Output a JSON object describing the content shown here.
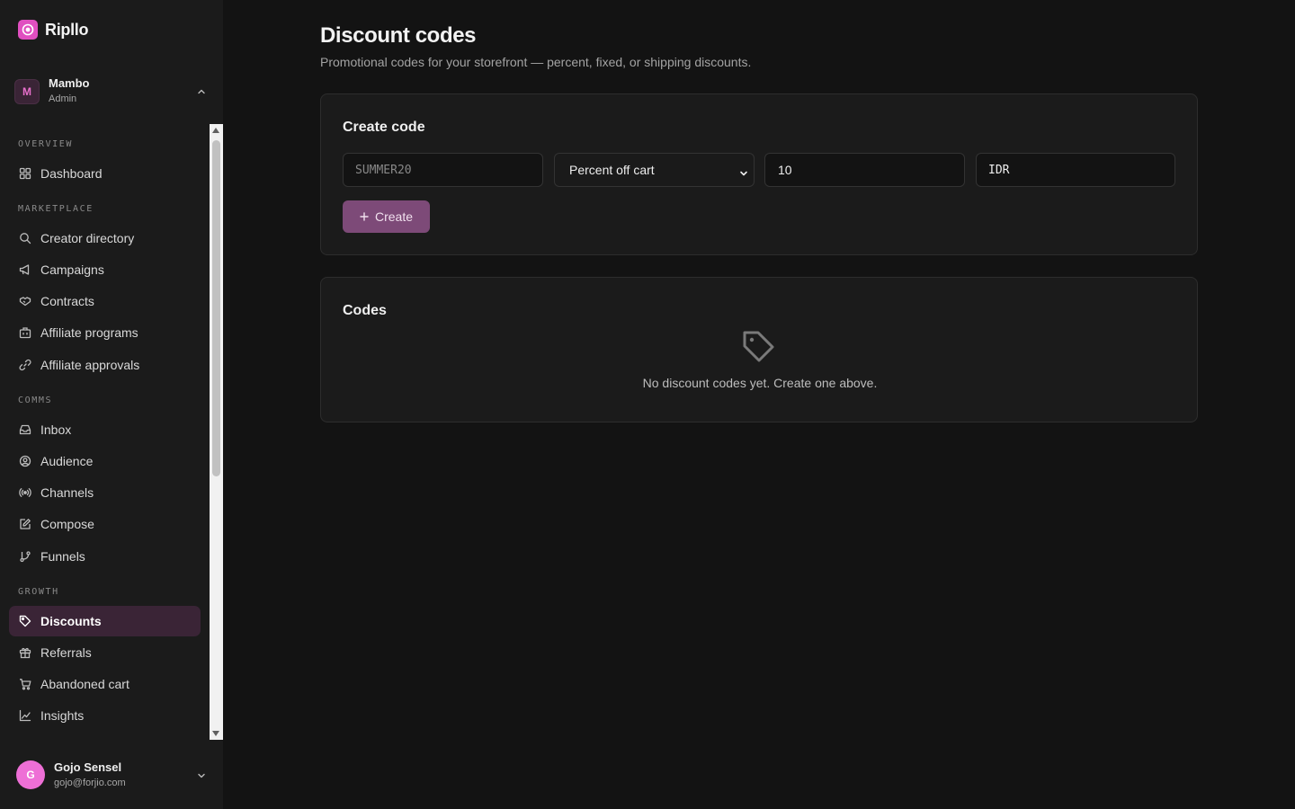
{
  "app": {
    "name": "Ripllo",
    "accent": "#e04fc0"
  },
  "workspace": {
    "initial": "M",
    "name": "Mambo",
    "role": "Admin"
  },
  "nav": {
    "sections": [
      {
        "label": "OVERVIEW",
        "items": [
          {
            "label": "Dashboard",
            "icon": "grid-icon"
          }
        ]
      },
      {
        "label": "MARKETPLACE",
        "items": [
          {
            "label": "Creator directory",
            "icon": "search-icon"
          },
          {
            "label": "Campaigns",
            "icon": "megaphone-icon"
          },
          {
            "label": "Contracts",
            "icon": "handshake-icon"
          },
          {
            "label": "Affiliate programs",
            "icon": "building-icon"
          },
          {
            "label": "Affiliate approvals",
            "icon": "link-icon"
          }
        ]
      },
      {
        "label": "COMMS",
        "items": [
          {
            "label": "Inbox",
            "icon": "inbox-icon"
          },
          {
            "label": "Audience",
            "icon": "user-circle-icon"
          },
          {
            "label": "Channels",
            "icon": "radio-icon"
          },
          {
            "label": "Compose",
            "icon": "edit-icon"
          },
          {
            "label": "Funnels",
            "icon": "git-branch-icon"
          }
        ]
      },
      {
        "label": "GROWTH",
        "items": [
          {
            "label": "Discounts",
            "icon": "tag-icon",
            "active": true
          },
          {
            "label": "Referrals",
            "icon": "gift-icon"
          },
          {
            "label": "Abandoned cart",
            "icon": "cart-icon"
          },
          {
            "label": "Insights",
            "icon": "line-chart-icon"
          }
        ]
      }
    ]
  },
  "user": {
    "initial": "G",
    "name": "Gojo Sensel",
    "email": "gojo@forjio.com"
  },
  "page": {
    "title": "Discount codes",
    "subtitle": "Promotional codes for your storefront — percent, fixed, or shipping discounts."
  },
  "create_card": {
    "title": "Create code",
    "code_placeholder": "SUMMER20",
    "type_value": "Percent off cart",
    "amount_value": "10",
    "currency_value": "IDR",
    "button_label": "Create"
  },
  "codes_card": {
    "title": "Codes",
    "empty_text": "No discount codes yet. Create one above."
  }
}
